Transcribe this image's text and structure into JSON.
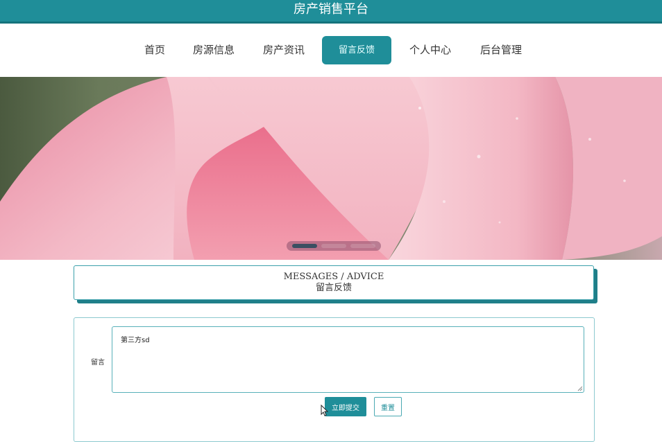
{
  "site": {
    "title": "房产销售平台"
  },
  "nav": {
    "items": [
      {
        "label": "首页"
      },
      {
        "label": "房源信息"
      },
      {
        "label": "房产资讯"
      },
      {
        "label": "留言反馈",
        "active": true
      },
      {
        "label": "个人中心"
      },
      {
        "label": "后台管理"
      }
    ]
  },
  "banner": {
    "slides": 3,
    "active_slide": 1
  },
  "section": {
    "title_en": "MESSAGES / ADVICE",
    "title_cn": "留言反馈"
  },
  "form": {
    "message_label": "留言",
    "message_value": "第三方sd",
    "submit_label": "立即提交",
    "reset_label": "重置"
  },
  "colors": {
    "primary": "#1f8e99",
    "header_shadow": "#1f7f89"
  }
}
